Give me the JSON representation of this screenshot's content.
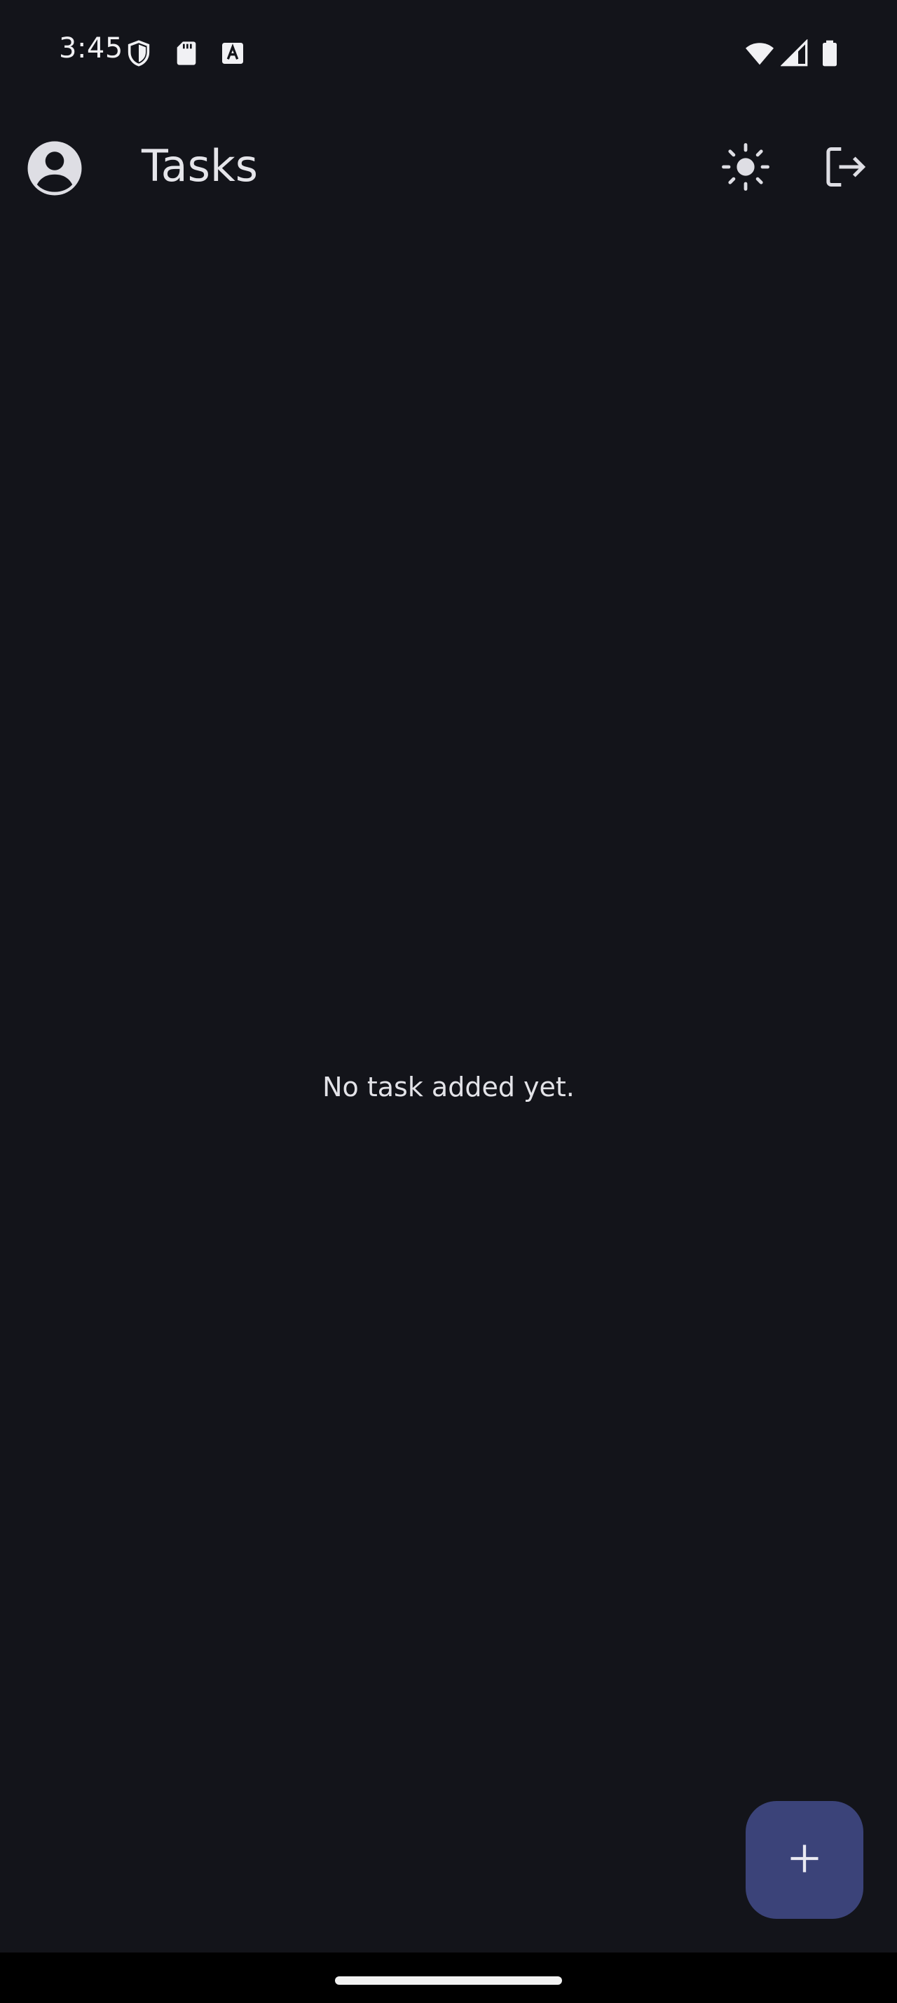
{
  "status_bar": {
    "time": "3:45",
    "left_icons": [
      "shield-icon",
      "sd-card-icon",
      "font-a-icon"
    ],
    "right_icons": [
      "wifi-icon",
      "cell-signal-icon",
      "battery-icon"
    ]
  },
  "app_bar": {
    "title": "Tasks",
    "avatar_icon": "account-circle-icon",
    "actions": [
      "brightness-icon",
      "logout-icon"
    ]
  },
  "main": {
    "empty_message": "No task added yet."
  },
  "fab": {
    "icon": "plus-icon"
  },
  "colors": {
    "background": "#13141a",
    "text": "#e3e3e8",
    "fab_background": "#3b4379",
    "nav_bar": "#000000"
  }
}
